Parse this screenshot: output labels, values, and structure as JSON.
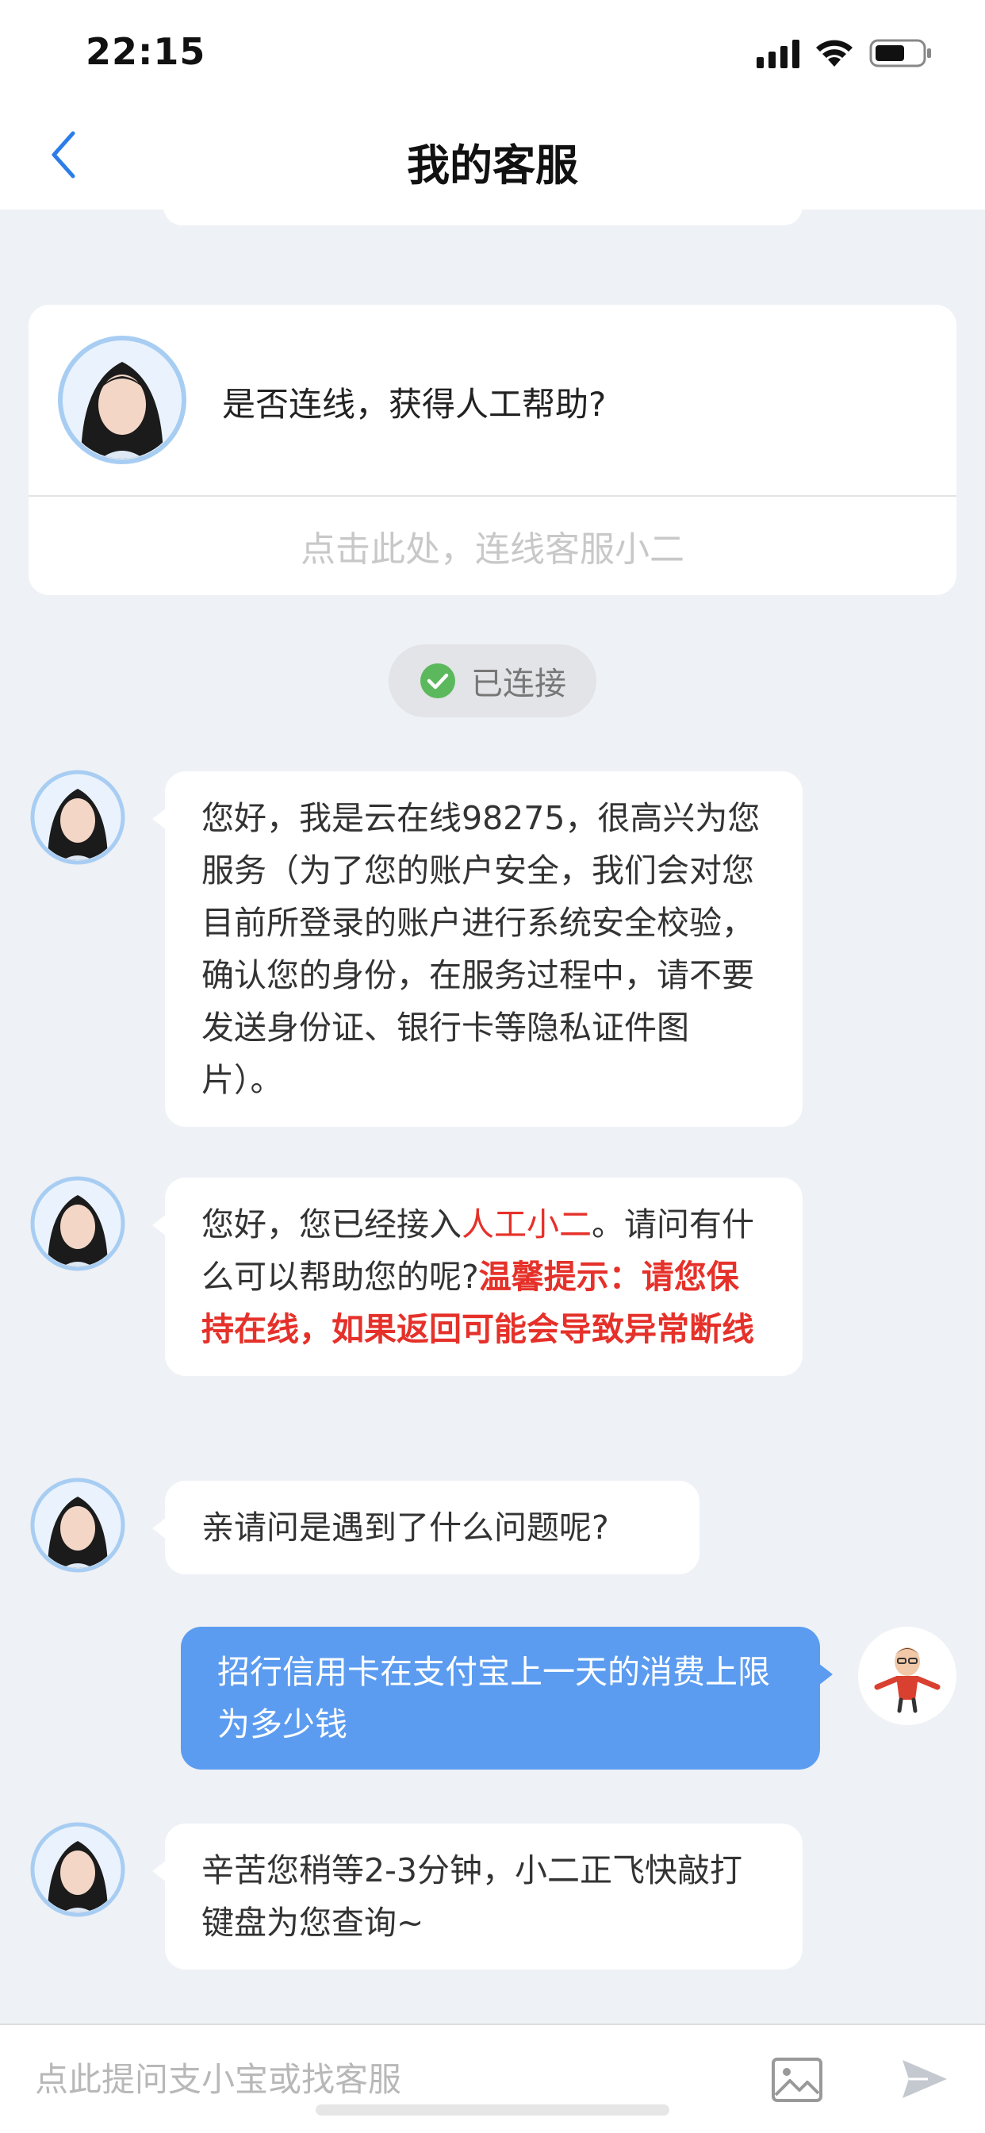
{
  "status_bar": {
    "time": "22:15"
  },
  "header": {
    "title": "我的客服"
  },
  "connect_card": {
    "question": "是否连线，获得人工帮助?",
    "action_label": "点击此处，连线客服小二"
  },
  "connected_badge": {
    "label": "已连接"
  },
  "messages": [
    {
      "sender": "agent",
      "text": "您好，我是云在线98275，很高兴为您服务（为了您的账户安全，我们会对您目前所登录的账户进行系统安全校验，确认您的身份，在服务过程中，请不要发送身份证、银行卡等隐私证件图片）。"
    },
    {
      "sender": "agent",
      "text_part1": "您好，您已经接入",
      "highlight": "人工小二",
      "text_part2": "。请问有什么可以帮助您的呢?",
      "notice": "温馨提示：请您保持在线，如果返回可能会导致异常断线"
    },
    {
      "sender": "agent",
      "text": "亲请问是遇到了什么问题呢?"
    },
    {
      "sender": "user",
      "text": "招行信用卡在支付宝上一天的消费上限为多少钱"
    },
    {
      "sender": "agent",
      "text": "辛苦您稍等2-3分钟，小二正飞快敲打键盘为您查询~"
    }
  ],
  "input_bar": {
    "placeholder": "点此提问支小宝或找客服"
  },
  "colors": {
    "accent": "#5b9cf0",
    "highlight_red": "#e5312a",
    "background": "#eef1f5",
    "check_green": "#5cb85c"
  }
}
